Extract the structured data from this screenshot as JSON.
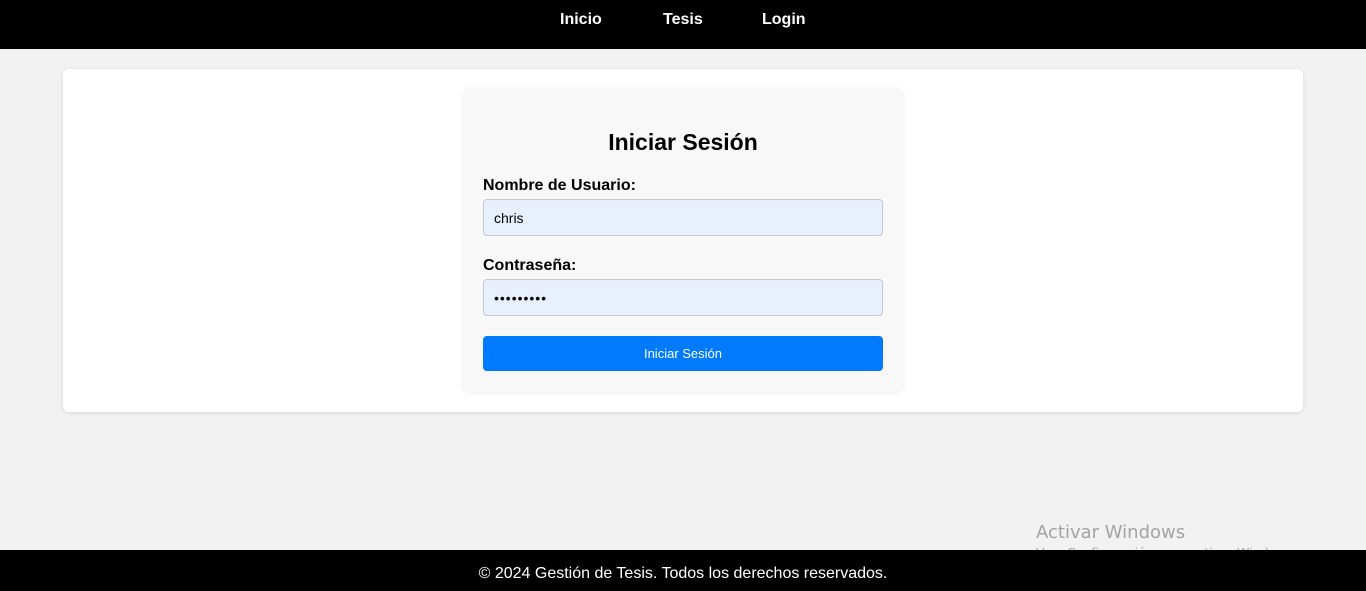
{
  "nav": {
    "items": [
      {
        "label": "Inicio"
      },
      {
        "label": "Tesis"
      },
      {
        "label": "Login"
      }
    ]
  },
  "login": {
    "title": "Iniciar Sesión",
    "username_label": "Nombre de Usuario:",
    "username_value": "chris",
    "password_label": "Contraseña:",
    "password_value": "•••••••••",
    "submit_label": "Iniciar Sesión"
  },
  "watermark": {
    "title": "Activar Windows",
    "subtitle": "Ve a Configuración para activar Windows."
  },
  "footer": {
    "text": "© 2024 Gestión de Tesis. Todos los derechos reservados."
  },
  "colors": {
    "nav_bg": "#000000",
    "page_bg": "#f2f2f2",
    "input_bg": "#e8f0fe",
    "button_bg": "#007bff",
    "footer_bg": "#000000"
  }
}
